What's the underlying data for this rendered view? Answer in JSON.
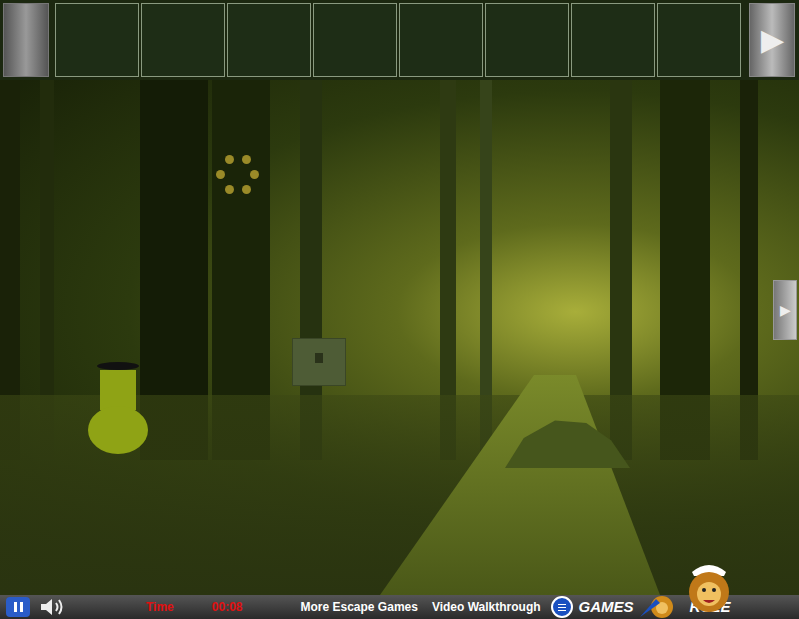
{
  "inventory": {
    "slots": [
      {
        "filled": false
      },
      {
        "filled": false
      },
      {
        "filled": false
      },
      {
        "filled": false
      },
      {
        "filled": false
      },
      {
        "filled": false
      },
      {
        "filled": false
      },
      {
        "filled": false
      }
    ]
  },
  "navigation": {
    "next_arrow": "▶",
    "scene_arrow": "▶"
  },
  "status_bar": {
    "sound_on": true,
    "time_label": "Time",
    "time": "00:08",
    "links": [
      "More Escape Games",
      "Video Walkthrough"
    ],
    "logo": [
      "GAMES",
      "RULE"
    ]
  }
}
